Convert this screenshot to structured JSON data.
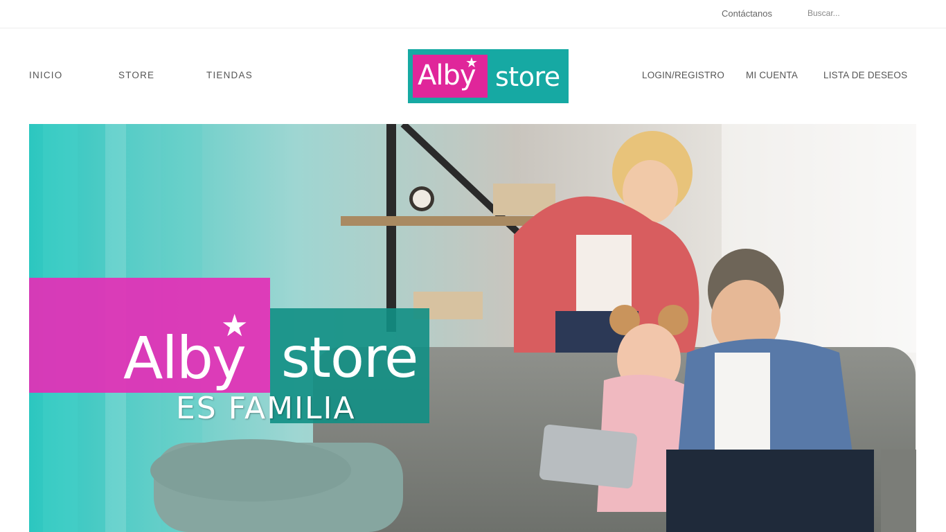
{
  "topbar": {
    "contact_label": "Contáctanos",
    "search_placeholder": "Buscar..."
  },
  "nav": {
    "left": [
      "INICIO",
      "STORE",
      "TIENDAS"
    ],
    "right": [
      "LOGIN/REGISTRO",
      "MI CUENTA",
      "LISTA DE DESEOS"
    ]
  },
  "logo": {
    "word1": "Alby",
    "word2": "store",
    "star": "★"
  },
  "hero": {
    "brand_word1": "Alby",
    "brand_word2": "store",
    "star": "★",
    "tagline": "ES FAMILIA"
  },
  "colors": {
    "brand_pink": "#e0269a",
    "brand_teal": "#16a9a3",
    "hero_pink": "#e42fb6",
    "hero_teal": "#118f84"
  }
}
